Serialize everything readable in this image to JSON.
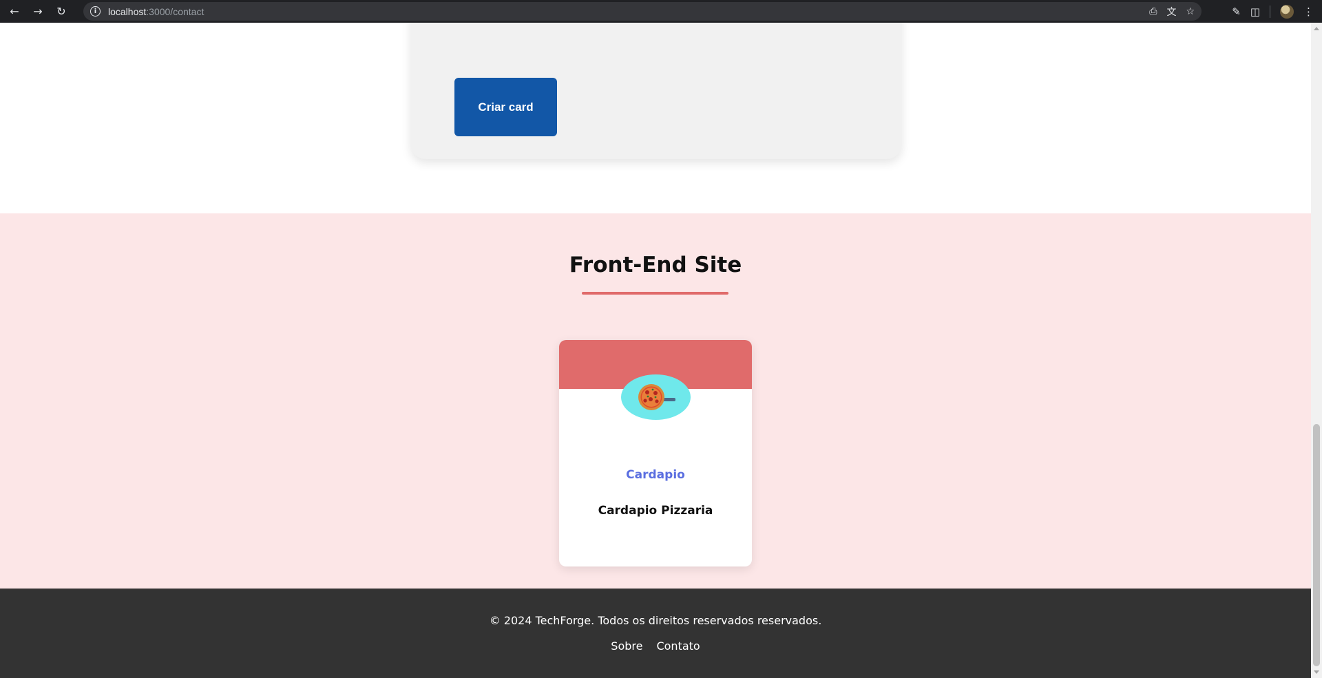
{
  "browser": {
    "url_host": "localhost",
    "url_path": ":3000/contact"
  },
  "form": {
    "create_label": "Criar card"
  },
  "projects": {
    "title": "Front-End Site",
    "cards": [
      {
        "title": "Cardapio",
        "description": "Cardapio Pizzaria",
        "image": "pizza-icon"
      }
    ]
  },
  "footer": {
    "copyright": "© 2024 TechForge. Todos os direitos reservados reservados.",
    "links": [
      "Sobre",
      "Contato"
    ]
  },
  "colors": {
    "primary_button": "#1257a7",
    "section_bg": "#fce6e7",
    "accent": "#e06b6b",
    "card_title": "#5a6ee0",
    "footer_bg": "#333333"
  }
}
